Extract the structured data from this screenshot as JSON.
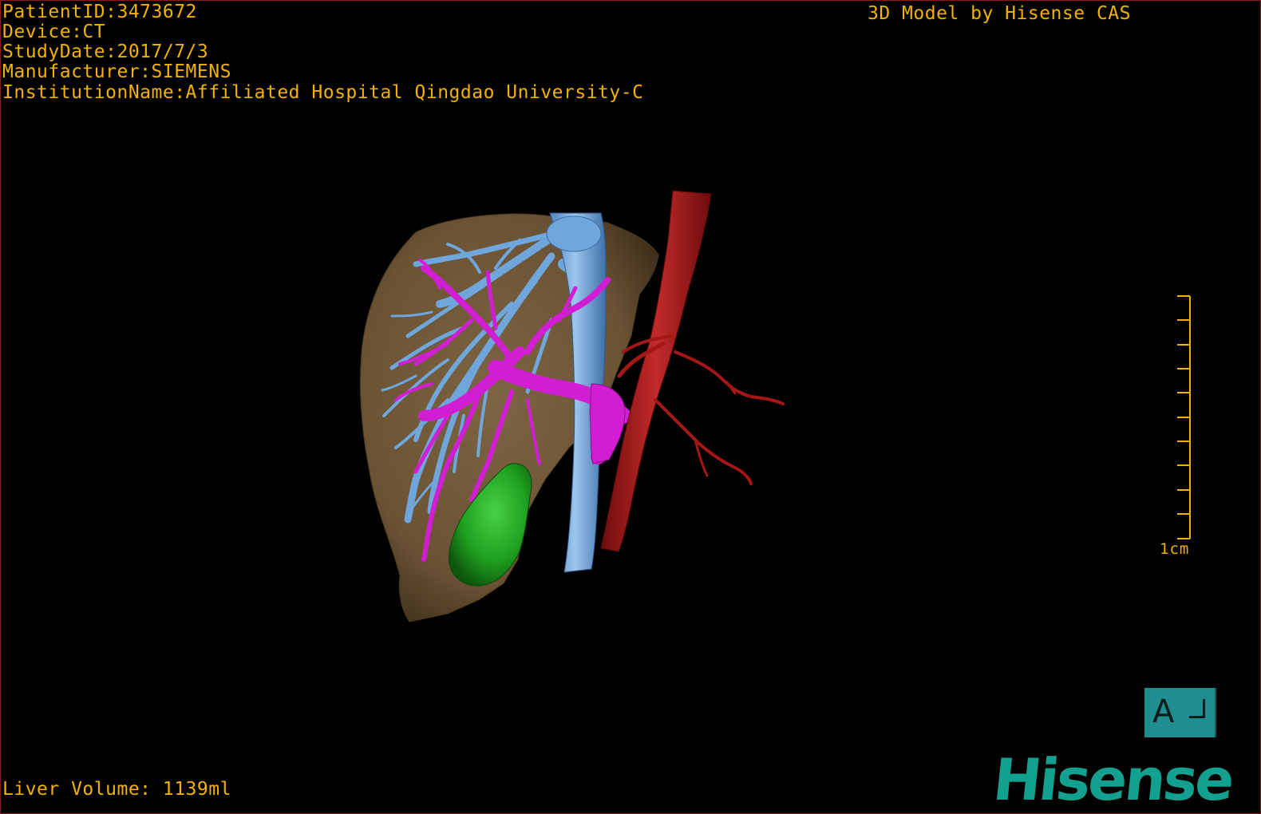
{
  "header_info": {
    "patient_id": "PatientID:3473672",
    "device": "Device:CT",
    "study_date": "StudyDate:2017/7/3",
    "manufacturer": "Manufacturer:SIEMENS",
    "institution": "InstitutionName:Affiliated Hospital Qingdao University-C"
  },
  "watermark_title": "3D Model by Hisense CAS",
  "footer": {
    "liver_volume": "Liver Volume: 1139ml"
  },
  "scale": {
    "label": "1cm",
    "tick_count": 11
  },
  "orientation": {
    "letter": "A"
  },
  "brand": {
    "name": "Hisense"
  },
  "model_colors": {
    "liver": "#7a6140",
    "hepatic_vein": "#6fa6dc",
    "portal_vein": "#d21ed2",
    "artery": "#a51616",
    "gallbladder": "#1fa11f",
    "text": "#f2b200",
    "brand": "#13a08e"
  }
}
